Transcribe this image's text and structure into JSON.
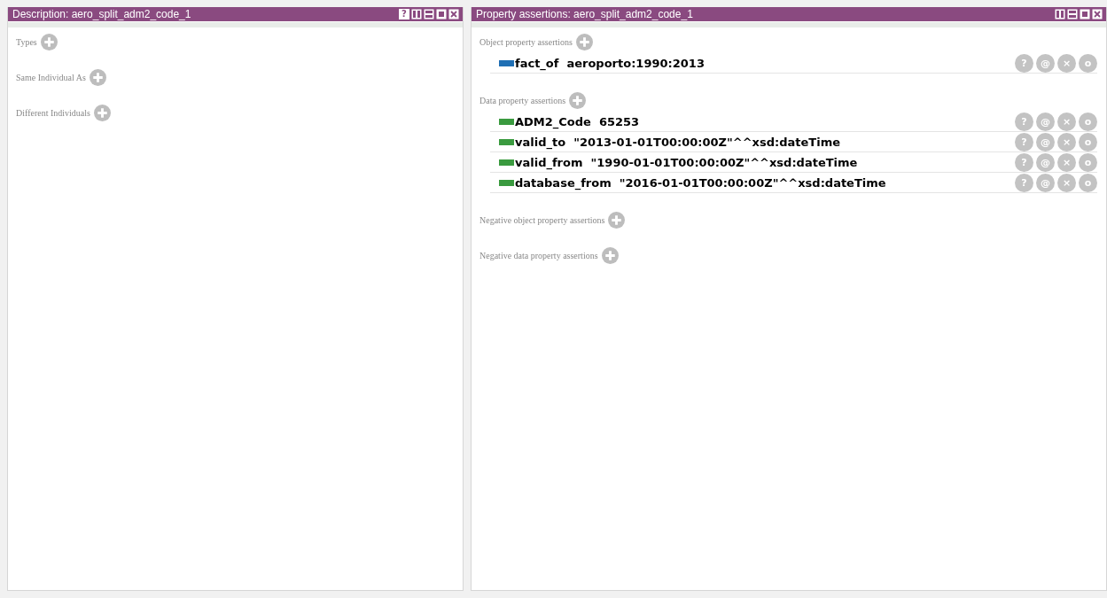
{
  "panels": [
    {
      "title": "Description: aero_split_adm2_code_1",
      "title_buttons": [
        {
          "kind": "help",
          "label": "?"
        },
        {
          "kind": "split-v"
        },
        {
          "kind": "split-h"
        },
        {
          "kind": "max"
        },
        {
          "kind": "close"
        }
      ],
      "sections": [
        {
          "label": "Types"
        },
        {
          "label": "Same Individual As"
        },
        {
          "label": "Different Individuals"
        }
      ]
    },
    {
      "title": "Property assertions: aero_split_adm2_code_1",
      "title_buttons": [
        {
          "kind": "split-v"
        },
        {
          "kind": "split-h"
        },
        {
          "kind": "max"
        },
        {
          "kind": "close"
        }
      ],
      "sections": [
        {
          "label": "Object property assertions",
          "items": [
            {
              "color": "#1f6fb4",
              "property": "fact_of",
              "value": "aeroporto:1990:2013",
              "actions": [
                "?",
                "@",
                "×",
                "o"
              ]
            }
          ]
        },
        {
          "label": "Data property assertions",
          "items": [
            {
              "color": "#3a9a3f",
              "property": "ADM2_Code",
              "value": "65253",
              "actions": [
                "?",
                "@",
                "×",
                "o"
              ]
            },
            {
              "color": "#3a9a3f",
              "property": "valid_to",
              "value": "\"2013-01-01T00:00:00Z\"^^xsd:dateTime",
              "actions": [
                "?",
                "@",
                "×",
                "o"
              ]
            },
            {
              "color": "#3a9a3f",
              "property": "valid_from",
              "value": "\"1990-01-01T00:00:00Z\"^^xsd:dateTime",
              "actions": [
                "?",
                "@",
                "×",
                "o"
              ]
            },
            {
              "color": "#3a9a3f",
              "property": "database_from",
              "value": "\"2016-01-01T00:00:00Z\"^^xsd:dateTime",
              "actions": [
                "?",
                "@",
                "×",
                "o"
              ]
            }
          ]
        },
        {
          "label": "Negative object property assertions"
        },
        {
          "label": "Negative data property assertions"
        }
      ]
    }
  ]
}
